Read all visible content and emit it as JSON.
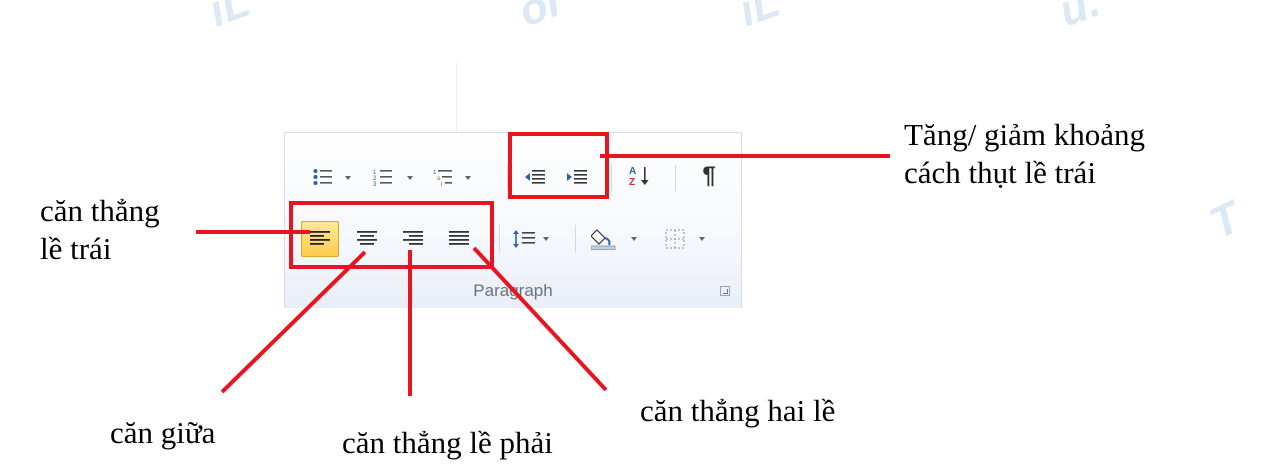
{
  "ribbon": {
    "group_label": "Paragraph",
    "row1": {
      "bullets": "bullets-icon",
      "numbering": "numbering-icon",
      "multilevel": "multilevel-list-icon",
      "decrease_indent": "decrease-indent-icon",
      "increase_indent": "increase-indent-icon",
      "sort": "sort-icon",
      "show_marks": "¶"
    },
    "row2": {
      "align_left": "align-left-icon",
      "align_center": "align-center-icon",
      "align_right": "align-right-icon",
      "justify": "justify-icon",
      "line_spacing": "line-spacing-icon",
      "shading": "shading-icon",
      "borders": "borders-icon"
    }
  },
  "annotations": {
    "indent": "Tăng/ giảm khoảng\ncách thụt lề trái",
    "align_left": "căn thẳng\nlề trái",
    "align_center": "căn giữa",
    "align_right": "căn thẳng lề phải",
    "justify": "căn thẳng hai lề"
  },
  "colors": {
    "annotation_red": "#e8141f",
    "active_button": "#ffcc4d",
    "watermark": "#dce8f6"
  }
}
